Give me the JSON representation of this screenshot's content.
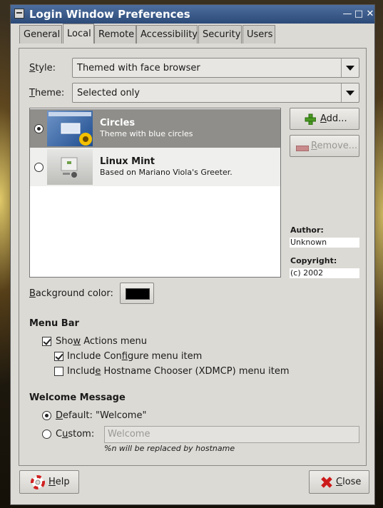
{
  "window": {
    "title": "Login Window Preferences",
    "minimize_glyph": "—",
    "maximize_glyph": "□",
    "close_glyph": "✕"
  },
  "tabs": [
    {
      "label": "General"
    },
    {
      "label": "Local"
    },
    {
      "label": "Remote"
    },
    {
      "label": "Accessibility"
    },
    {
      "label": "Security"
    },
    {
      "label": "Users"
    }
  ],
  "active_tab": "Local",
  "style": {
    "label_first": "S",
    "label_rest": "tyle:",
    "value": "Themed with face browser"
  },
  "theme": {
    "label_first": "T",
    "label_rest": "heme:",
    "value": "Selected only"
  },
  "themes": [
    {
      "name": "Circles",
      "description": "Theme with blue circles",
      "selected": true
    },
    {
      "name": "Linux Mint",
      "description": "Based on Mariano Viola's Greeter.",
      "selected": false
    }
  ],
  "buttons": {
    "add_label_first": "A",
    "add_label_rest": "dd...",
    "remove_label_first": "R",
    "remove_label_rest": "emove...",
    "help_label_first": "H",
    "help_label_rest": "elp",
    "close_label_first": "C",
    "close_label_rest": "lose"
  },
  "info": {
    "author_label": "Author:",
    "author_value": "Unknown",
    "copyright_label": "Copyright:",
    "copyright_value": "(c) 2002"
  },
  "background": {
    "label_first": "B",
    "label_rest": "ackground color:",
    "color": "#000000"
  },
  "menu_bar": {
    "heading": "Menu Bar",
    "show_actions_a": "Sho",
    "show_actions_u": "w",
    "show_actions_b": " Actions menu",
    "show_actions_checked": true,
    "configure_a": "Include Con",
    "configure_u": "f",
    "configure_b": "igure menu item",
    "configure_checked": true,
    "hostname_a": "Includ",
    "hostname_u": "e",
    "hostname_b": " Hostname Chooser (XDMCP) menu item",
    "hostname_checked": false
  },
  "welcome": {
    "heading": "Welcome Message",
    "default_u": "D",
    "default_rest": "efault: \"Welcome\"",
    "custom_a": "C",
    "custom_u": "u",
    "custom_b": "stom:",
    "custom_value": "Welcome",
    "hint": "%n will be replaced by hostname",
    "selected": "default"
  },
  "colors": {
    "titlebar": "#3b5c8c",
    "selection": "#8f8e8a",
    "window_bg": "#dcdad5"
  },
  "icons": {
    "add": "green-plus-icon",
    "remove": "remove-icon",
    "help": "lifebuoy-icon",
    "close": "red-x-icon"
  }
}
